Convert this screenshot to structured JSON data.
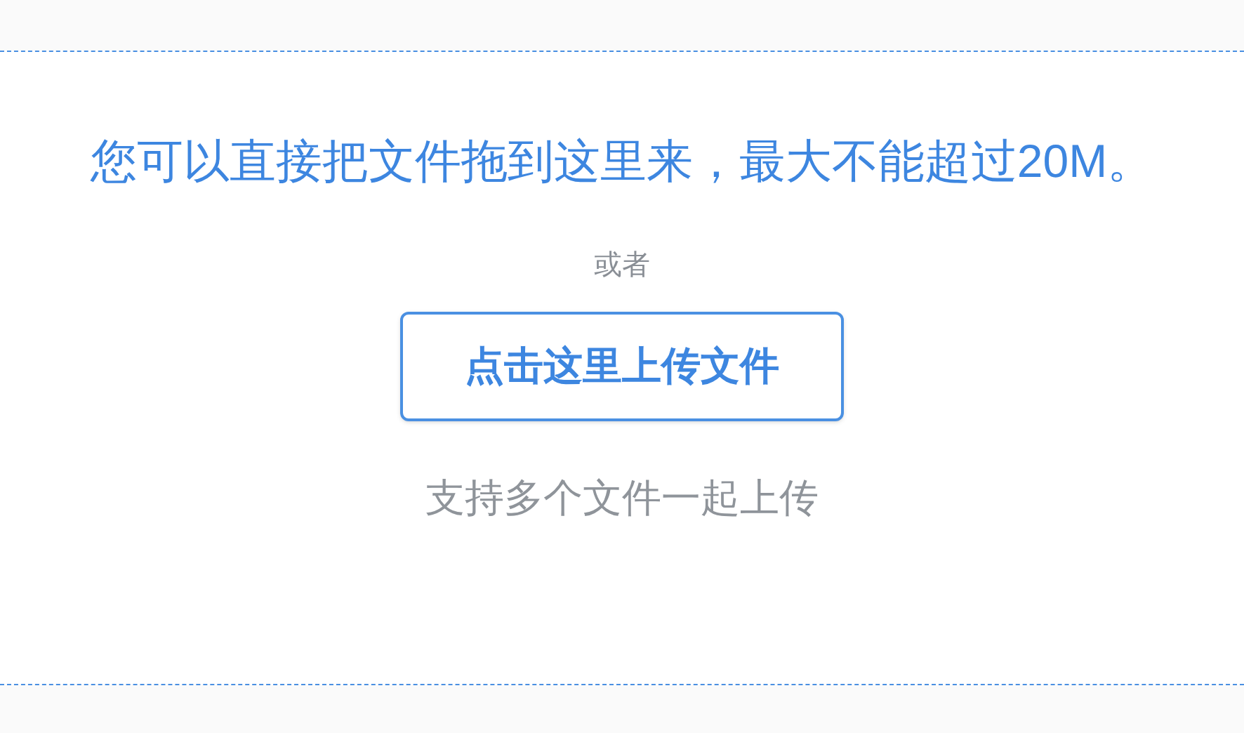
{
  "drop_zone": {
    "message": "您可以直接把文件拖到这里来，最大不能超过20M。",
    "separator": "或者",
    "upload_button": {
      "label": "点击这里上传文件"
    },
    "hint": "支持多个文件一起上传"
  }
}
